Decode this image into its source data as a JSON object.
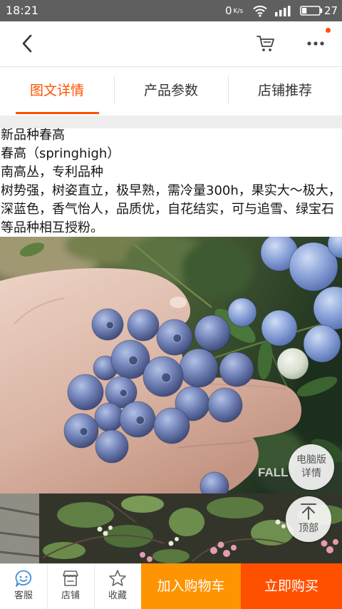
{
  "status_bar": {
    "time": "18:21",
    "net_speed": "0",
    "net_unit": "K/s",
    "battery": "27",
    "battery_level": 0.27,
    "icons": [
      "wifi-icon",
      "signal-icon",
      "battery-icon"
    ]
  },
  "header": {
    "icons": {
      "back": "back-arrow-icon",
      "cart": "cart-icon",
      "more": "more-dots-icon"
    },
    "notification_dot_color": "#ff5000"
  },
  "tabs": [
    {
      "label": "图文详情",
      "active": true
    },
    {
      "label": "产品参数",
      "active": false
    },
    {
      "label": "店铺推荐",
      "active": false
    }
  ],
  "detail": {
    "title": "新品种春高",
    "variety": "春高（springhigh）",
    "category": "南高丛，专利品种",
    "description": "树势强，树姿直立，极早熟，需冷量300h，果实大～极大，深蓝色，香气怡人，品质优，自花结实，可与追雪、绿宝石等品种相互授粉。"
  },
  "photos": {
    "watermark": "FALL"
  },
  "float_buttons": {
    "desktop_line1": "电脑版",
    "desktop_line2": "详情",
    "back_to_top": "顶部"
  },
  "bottom_bar": {
    "service": "客服",
    "shop": "店铺",
    "favorite": "收藏",
    "add_to_cart": "加入购物车",
    "buy_now": "立即购买",
    "icons": [
      "customer-service-icon",
      "shop-icon",
      "star-icon"
    ]
  },
  "colors": {
    "accent": "#ff5000",
    "add_to_cart_bg": "#ff9402",
    "buy_now_bg": "#ff5000",
    "status_bar_bg": "#5f5f5f"
  }
}
